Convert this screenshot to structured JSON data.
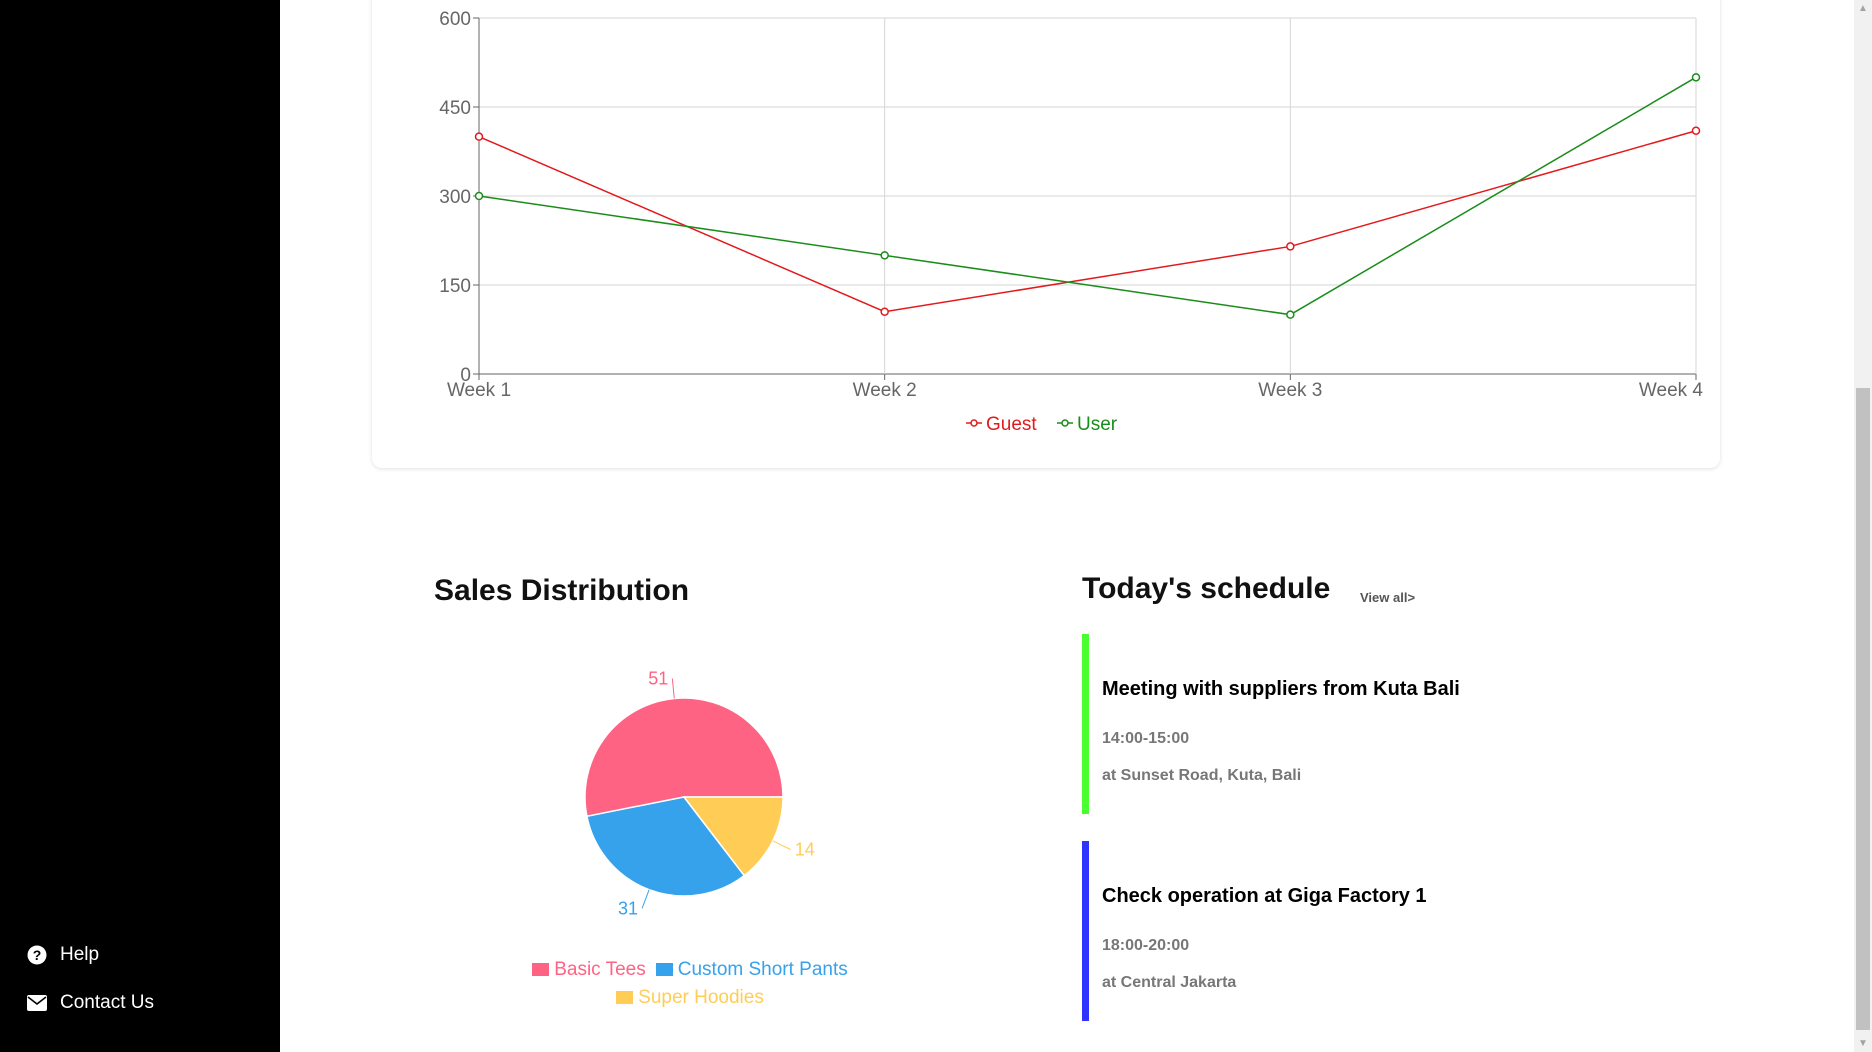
{
  "sidebar": {
    "help_label": "Help",
    "contact_label": "Contact Us"
  },
  "line_chart": {
    "chart_data": {
      "type": "line",
      "categories": [
        "Week 1",
        "Week 2",
        "Week 3",
        "Week 4"
      ],
      "y_ticks": [
        "0",
        "150",
        "300",
        "450",
        "600"
      ],
      "ylim": [
        0,
        600
      ],
      "grid": true,
      "legend_position": "bottom",
      "series": [
        {
          "name": "Guest",
          "color": "#e31a1c",
          "values": [
            400,
            105,
            215,
            410
          ]
        },
        {
          "name": "User",
          "color": "#1a8c1a",
          "values": [
            300,
            200,
            100,
            500
          ]
        }
      ]
    }
  },
  "sales": {
    "title": "Sales Distribution",
    "chart_data": {
      "type": "pie",
      "labels": [
        "Basic Tees",
        "Custom Short Pants",
        "Super Hoodies"
      ],
      "values": [
        51,
        31,
        14
      ],
      "colors": [
        "#ff6384",
        "#36a2eb",
        "#ffcd56"
      ],
      "legend_position": "bottom"
    }
  },
  "schedule": {
    "title": "Today's schedule",
    "view_all": "View all>",
    "events": [
      {
        "title": "Meeting with suppliers from Kuta Bali",
        "time": "14:00-15:00",
        "location": "at Sunset Road, Kuta, Bali",
        "color": "#4aff2f"
      },
      {
        "title": "Check operation at Giga Factory 1",
        "time": "18:00-20:00",
        "location": "at Central Jakarta",
        "color": "#2f35ff"
      }
    ]
  },
  "icons": {
    "help": "question-circle-icon",
    "contact": "envelope-icon"
  }
}
